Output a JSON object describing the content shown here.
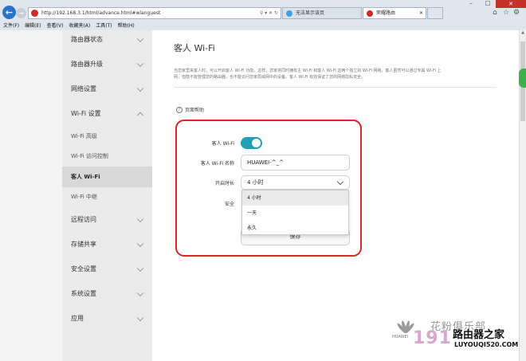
{
  "browser": {
    "address": "http://192.168.3.1/html/advance.html#wlanguest",
    "tabs": [
      {
        "label": "无法显示该页"
      },
      {
        "label": "荣耀路由"
      }
    ],
    "menu": [
      "文件(F)",
      "编辑(E)",
      "查看(V)",
      "收藏夹(A)",
      "工具(T)",
      "帮助(H)"
    ]
  },
  "sidebar": {
    "items": [
      {
        "label": "路由器状态",
        "type": "main",
        "chevron": "down"
      },
      {
        "label": "路由器升级",
        "type": "main",
        "chevron": "down"
      },
      {
        "label": "网络设置",
        "type": "main",
        "chevron": "down"
      },
      {
        "label": "Wi-Fi 设置",
        "type": "main",
        "chevron": "up"
      },
      {
        "label": "Wi-Fi 高级",
        "type": "sub"
      },
      {
        "label": "Wi-Fi 访问控制",
        "type": "sub"
      },
      {
        "label": "客人 Wi-Fi",
        "type": "sub",
        "active": true
      },
      {
        "label": "Wi-Fi 中继",
        "type": "sub"
      },
      {
        "label": "远程访问",
        "type": "main",
        "chevron": "down"
      },
      {
        "label": "存储共享",
        "type": "main",
        "chevron": "down"
      },
      {
        "label": "安全设置",
        "type": "main",
        "chevron": "down"
      },
      {
        "label": "系统设置",
        "type": "main",
        "chevron": "down"
      },
      {
        "label": "应用",
        "type": "main",
        "chevron": "down"
      }
    ]
  },
  "main": {
    "title": "客人 Wi-Fi",
    "description": "当您家里来客人时，可以开启客人 Wi-Fi 功能。这样，您家将同时拥有主 Wi-Fi 和客人 Wi-Fi 这两个独立的 Wi-Fi 网络。客人虽然可以通过专属 Wi-Fi 上网，但既不能管理您的路由器，也不能访问您家局域网中的设备。客人 Wi-Fi 有效保证了您的网络隐私安全。",
    "help_link": "页面帮助",
    "form": {
      "guest_wifi_label": "客人 Wi-Fi",
      "guest_wifi_enabled": true,
      "name_label": "客人 Wi-Fi 名称",
      "name_value": "HUAWEI-^_^",
      "duration_label": "开启时长",
      "duration_value": "4 小时",
      "security_label": "安全",
      "duration_options": [
        "4 小时",
        "一天",
        "永久"
      ],
      "save_label": "保存"
    }
  },
  "watermark": {
    "huawei": "HUAWEI",
    "cn_text": "花粉俱乐部",
    "number": "191",
    "brand": "路由器之家",
    "url": "LUYOUQI520.COM"
  },
  "colors": {
    "accent": "#1ea1b5",
    "highlight": "#e02426",
    "ie_blue": "#2a74c8"
  }
}
